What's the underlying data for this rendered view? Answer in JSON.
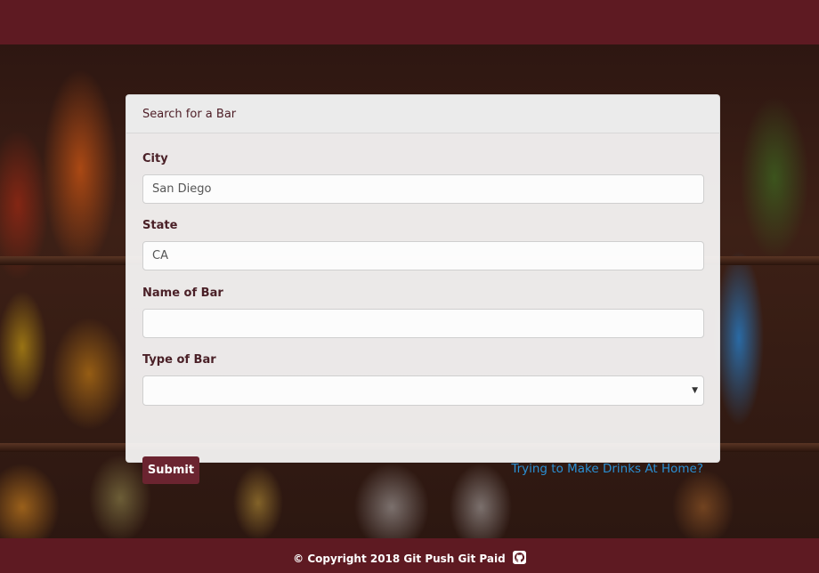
{
  "panel": {
    "title": "Search for a Bar"
  },
  "form": {
    "city": {
      "label": "City",
      "value": "San Diego",
      "placeholder": ""
    },
    "state": {
      "label": "State",
      "value": "CA",
      "placeholder": ""
    },
    "bar_name": {
      "label": "Name of Bar",
      "value": "",
      "placeholder": ""
    },
    "bar_type": {
      "label": "Type of Bar",
      "selected": ""
    },
    "submit_label": "Submit",
    "home_link": "Trying to Make Drinks At Home?"
  },
  "footer": {
    "text": "© Copyright 2018 Git Push Git Paid",
    "icon": "github-icon"
  },
  "colors": {
    "brand": "#5e1a22",
    "button": "#6b2430",
    "link": "#2a8fd3"
  }
}
